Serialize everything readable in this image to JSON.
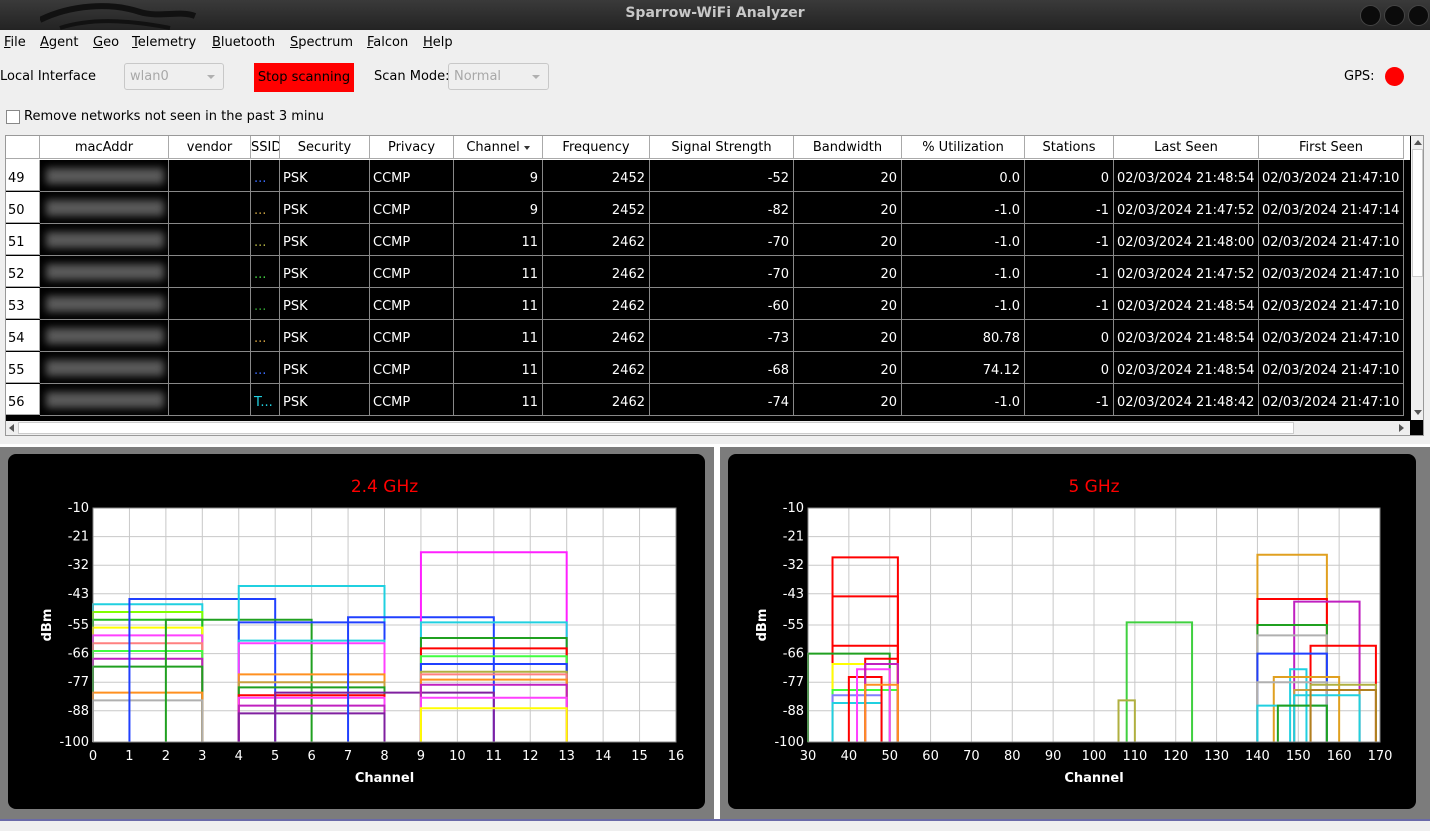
{
  "window": {
    "title": "Sparrow-WiFi Analyzer"
  },
  "menu": [
    {
      "label": "File",
      "u": "F",
      "rest": "ile"
    },
    {
      "label": "Agent",
      "u": "A",
      "rest": "gent"
    },
    {
      "label": "Geo",
      "u": "G",
      "rest": "eo"
    },
    {
      "label": "Telemetry",
      "u": "T",
      "rest": "elemetry"
    },
    {
      "label": "Bluetooth",
      "u": "B",
      "rest": "luetooth"
    },
    {
      "label": "Spectrum",
      "u": "S",
      "rest": "pectrum"
    },
    {
      "label": "Falcon",
      "u": "F",
      "rest": "alcon"
    },
    {
      "label": "Help",
      "u": "H",
      "rest": "elp"
    }
  ],
  "toolbar": {
    "local_interface_label": "Local Interface",
    "interface_value": "wlan0",
    "stop_label": "Stop scanning",
    "scan_mode_label": "Scan Mode:",
    "scan_mode_value": "Normal",
    "gps_label": "GPS:",
    "gps_color": "#ff0000"
  },
  "filter": {
    "remove_label": "Remove networks not seen in the past 3 minu"
  },
  "table": {
    "columns": [
      "macAddr",
      "vendor",
      "SSID",
      "Security",
      "Privacy",
      "Channel",
      "Frequency",
      "Signal Strength",
      "Bandwidth",
      "% Utilization",
      "Stations",
      "Last Seen",
      "First Seen"
    ],
    "rows": [
      {
        "num": "49",
        "ssid": "...",
        "ssid_color": "#3a6cff",
        "security": "PSK",
        "privacy": "CCMP",
        "channel": "9",
        "frequency": "2452",
        "signal": "-52",
        "bandwidth": "20",
        "util": "0.0",
        "stations": "0",
        "last": "02/03/2024 21:48:54",
        "first": "02/03/2024 21:47:10"
      },
      {
        "num": "50",
        "ssid": "...",
        "ssid_color": "#c8a040",
        "security": "PSK",
        "privacy": "CCMP",
        "channel": "9",
        "frequency": "2452",
        "signal": "-82",
        "bandwidth": "20",
        "util": "-1.0",
        "stations": "-1",
        "last": "02/03/2024 21:47:52",
        "first": "02/03/2024 21:47:14"
      },
      {
        "num": "51",
        "ssid": "...",
        "ssid_color": "#b0b040",
        "security": "PSK",
        "privacy": "CCMP",
        "channel": "11",
        "frequency": "2462",
        "signal": "-70",
        "bandwidth": "20",
        "util": "-1.0",
        "stations": "-1",
        "last": "02/03/2024 21:48:00",
        "first": "02/03/2024 21:47:10"
      },
      {
        "num": "52",
        "ssid": "...",
        "ssid_color": "#40d040",
        "security": "PSK",
        "privacy": "CCMP",
        "channel": "11",
        "frequency": "2462",
        "signal": "-70",
        "bandwidth": "20",
        "util": "-1.0",
        "stations": "-1",
        "last": "02/03/2024 21:47:52",
        "first": "02/03/2024 21:47:10"
      },
      {
        "num": "53",
        "ssid": "...",
        "ssid_color": "#30a030",
        "security": "PSK",
        "privacy": "CCMP",
        "channel": "11",
        "frequency": "2462",
        "signal": "-60",
        "bandwidth": "20",
        "util": "-1.0",
        "stations": "-1",
        "last": "02/03/2024 21:48:54",
        "first": "02/03/2024 21:47:10"
      },
      {
        "num": "54",
        "ssid": "...",
        "ssid_color": "#d0a040",
        "security": "PSK",
        "privacy": "CCMP",
        "channel": "11",
        "frequency": "2462",
        "signal": "-73",
        "bandwidth": "20",
        "util": "80.78",
        "stations": "0",
        "last": "02/03/2024 21:48:54",
        "first": "02/03/2024 21:47:10"
      },
      {
        "num": "55",
        "ssid": "...",
        "ssid_color": "#3a6cff",
        "security": "PSK",
        "privacy": "CCMP",
        "channel": "11",
        "frequency": "2462",
        "signal": "-68",
        "bandwidth": "20",
        "util": "74.12",
        "stations": "0",
        "last": "02/03/2024 21:48:54",
        "first": "02/03/2024 21:47:10"
      },
      {
        "num": "56",
        "ssid": "T...",
        "ssid_color": "#20d0e0",
        "security": "PSK",
        "privacy": "CCMP",
        "channel": "11",
        "frequency": "2462",
        "signal": "-74",
        "bandwidth": "20",
        "util": "-1.0",
        "stations": "-1",
        "last": "02/03/2024 21:48:42",
        "first": "02/03/2024 21:47:10"
      }
    ]
  },
  "chart_data": [
    {
      "type": "area",
      "title": "2.4 GHz",
      "xlabel": "Channel",
      "ylabel": "dBm",
      "xlim": [
        0,
        16
      ],
      "ylim": [
        -100,
        -10
      ],
      "xticks": [
        "0",
        "1",
        "2",
        "3",
        "4",
        "5",
        "6",
        "7",
        "8",
        "9",
        "10",
        "11",
        "12",
        "13",
        "14",
        "15",
        "16"
      ],
      "yticks": [
        "-10",
        "-21",
        "-32",
        "-43",
        "-55",
        "-66",
        "-77",
        "-88",
        "-100"
      ],
      "title_color": "#ff0000",
      "series": [
        {
          "x0": 0,
          "x1": 3,
          "signal": -47,
          "color": "#20d0e0"
        },
        {
          "x0": 0,
          "x1": 3,
          "signal": -50,
          "color": "#80ff00"
        },
        {
          "x0": 0,
          "x1": 3,
          "signal": -53,
          "color": "#20c020"
        },
        {
          "x0": 0,
          "x1": 3,
          "signal": -56,
          "color": "#ffff00"
        },
        {
          "x0": 0,
          "x1": 3,
          "signal": -59,
          "color": "#ff40ff"
        },
        {
          "x0": 0,
          "x1": 3,
          "signal": -62,
          "color": "#ff8080"
        },
        {
          "x0": 0,
          "x1": 3,
          "signal": -65,
          "color": "#40ff40"
        },
        {
          "x0": 0,
          "x1": 3,
          "signal": -68,
          "color": "#c020c0"
        },
        {
          "x0": 0,
          "x1": 3,
          "signal": -71,
          "color": "#20a020"
        },
        {
          "x0": 0,
          "x1": 3,
          "signal": -81,
          "color": "#ff9020"
        },
        {
          "x0": 0,
          "x1": 3,
          "signal": -84,
          "color": "#b0b0b0"
        },
        {
          "x0": 1,
          "x1": 5,
          "signal": -45,
          "color": "#2040ff"
        },
        {
          "x0": 2,
          "x1": 6,
          "signal": -53,
          "color": "#20a020"
        },
        {
          "x0": 4,
          "x1": 8,
          "signal": -40,
          "color": "#20d0e0"
        },
        {
          "x0": 4,
          "x1": 8,
          "signal": -54,
          "color": "#2040ff"
        },
        {
          "x0": 4,
          "x1": 8,
          "signal": -61,
          "color": "#20d0e0"
        },
        {
          "x0": 4,
          "x1": 8,
          "signal": -62,
          "color": "#ff40ff"
        },
        {
          "x0": 4,
          "x1": 8,
          "signal": -74,
          "color": "#ff9020"
        },
        {
          "x0": 4,
          "x1": 8,
          "signal": -77,
          "color": "#c8a040"
        },
        {
          "x0": 4,
          "x1": 8,
          "signal": -79,
          "color": "#20a020"
        },
        {
          "x0": 4,
          "x1": 8,
          "signal": -82,
          "color": "#ff0000"
        },
        {
          "x0": 4,
          "x1": 8,
          "signal": -83,
          "color": "#ff40ff"
        },
        {
          "x0": 4,
          "x1": 8,
          "signal": -86,
          "color": "#c020c0"
        },
        {
          "x0": 4,
          "x1": 8,
          "signal": -89,
          "color": "#8020a0"
        },
        {
          "x0": 7,
          "x1": 11,
          "signal": -52,
          "color": "#2040ff"
        },
        {
          "x0": 5,
          "x1": 11,
          "signal": -81,
          "color": "#8020a0"
        },
        {
          "x0": 9,
          "x1": 13,
          "signal": -27,
          "color": "#ff20ff"
        },
        {
          "x0": 9,
          "x1": 13,
          "signal": -54,
          "color": "#20d0e0"
        },
        {
          "x0": 9,
          "x1": 13,
          "signal": -60,
          "color": "#20a020"
        },
        {
          "x0": 9,
          "x1": 13,
          "signal": -64,
          "color": "#ff0000"
        },
        {
          "x0": 9,
          "x1": 13,
          "signal": -67,
          "color": "#40ff40"
        },
        {
          "x0": 9,
          "x1": 13,
          "signal": -70,
          "color": "#2040ff"
        },
        {
          "x0": 9,
          "x1": 13,
          "signal": -73,
          "color": "#b0b040"
        },
        {
          "x0": 9,
          "x1": 13,
          "signal": -74,
          "color": "#ff8080"
        },
        {
          "x0": 9,
          "x1": 13,
          "signal": -76,
          "color": "#ff9020"
        },
        {
          "x0": 9,
          "x1": 13,
          "signal": -78,
          "color": "#c020c0"
        },
        {
          "x0": 9,
          "x1": 13,
          "signal": -83,
          "color": "#ff40ff"
        },
        {
          "x0": 9,
          "x1": 13,
          "signal": -87,
          "color": "#ffff00"
        }
      ]
    },
    {
      "type": "area",
      "title": "5 GHz",
      "xlabel": "Channel",
      "ylabel": "dBm",
      "xlim": [
        30,
        170
      ],
      "ylim": [
        -100,
        -10
      ],
      "xticks": [
        "30",
        "40",
        "50",
        "60",
        "70",
        "80",
        "90",
        "100",
        "110",
        "120",
        "130",
        "140",
        "150",
        "160",
        "170"
      ],
      "yticks": [
        "-10",
        "-21",
        "-32",
        "-43",
        "-55",
        "-66",
        "-77",
        "-88",
        "-100"
      ],
      "title_color": "#ff0000",
      "series": [
        {
          "x0": 36,
          "x1": 52,
          "signal": -29,
          "color": "#ff0000"
        },
        {
          "x0": 36,
          "x1": 52,
          "signal": -44,
          "color": "#ff0000"
        },
        {
          "x0": 36,
          "x1": 52,
          "signal": -63,
          "color": "#ff0000"
        },
        {
          "x0": 30,
          "x1": 50,
          "signal": -66,
          "color": "#20a020"
        },
        {
          "x0": 36,
          "x1": 52,
          "signal": -70,
          "color": "#ffff00"
        },
        {
          "x0": 36,
          "x1": 52,
          "signal": -80,
          "color": "#40ff40"
        },
        {
          "x0": 36,
          "x1": 48,
          "signal": -82,
          "color": "#8080ff"
        },
        {
          "x0": 36,
          "x1": 48,
          "signal": -85,
          "color": "#20d0e0"
        },
        {
          "x0": 40,
          "x1": 48,
          "signal": -75,
          "color": "#ff0000"
        },
        {
          "x0": 42,
          "x1": 50,
          "signal": -72,
          "color": "#ff40ff"
        },
        {
          "x0": 44,
          "x1": 52,
          "signal": -68,
          "color": "#ff0000"
        },
        {
          "x0": 44,
          "x1": 52,
          "signal": -70,
          "color": "#c020c0"
        },
        {
          "x0": 44,
          "x1": 52,
          "signal": -78,
          "color": "#ff9020"
        },
        {
          "x0": 108,
          "x1": 124,
          "signal": -54,
          "color": "#40d040"
        },
        {
          "x0": 106,
          "x1": 110,
          "signal": -84,
          "color": "#b0b040"
        },
        {
          "x0": 140,
          "x1": 157,
          "signal": -28,
          "color": "#e0a020"
        },
        {
          "x0": 140,
          "x1": 157,
          "signal": -45,
          "color": "#ff0000"
        },
        {
          "x0": 149,
          "x1": 165,
          "signal": -46,
          "color": "#c020c0"
        },
        {
          "x0": 140,
          "x1": 157,
          "signal": -55,
          "color": "#20a020"
        },
        {
          "x0": 140,
          "x1": 157,
          "signal": -59,
          "color": "#b0b0b0"
        },
        {
          "x0": 153,
          "x1": 169,
          "signal": -63,
          "color": "#ff0000"
        },
        {
          "x0": 140,
          "x1": 157,
          "signal": -66,
          "color": "#2040ff"
        },
        {
          "x0": 148,
          "x1": 152,
          "signal": -72,
          "color": "#20d0e0"
        },
        {
          "x0": 144,
          "x1": 160,
          "signal": -75,
          "color": "#e0a020"
        },
        {
          "x0": 140,
          "x1": 157,
          "signal": -77,
          "color": "#b0b0b0"
        },
        {
          "x0": 153,
          "x1": 169,
          "signal": -78,
          "color": "#b0b040"
        },
        {
          "x0": 149,
          "x1": 165,
          "signal": -80,
          "color": "#c8a040"
        },
        {
          "x0": 149,
          "x1": 165,
          "signal": -82,
          "color": "#20d0e0"
        },
        {
          "x0": 140,
          "x1": 157,
          "signal": -86,
          "color": "#20d0e0"
        },
        {
          "x0": 145,
          "x1": 157,
          "signal": -86,
          "color": "#20a020"
        },
        {
          "x0": 153,
          "x1": 169,
          "signal": -80,
          "color": "#b08020"
        }
      ]
    }
  ]
}
